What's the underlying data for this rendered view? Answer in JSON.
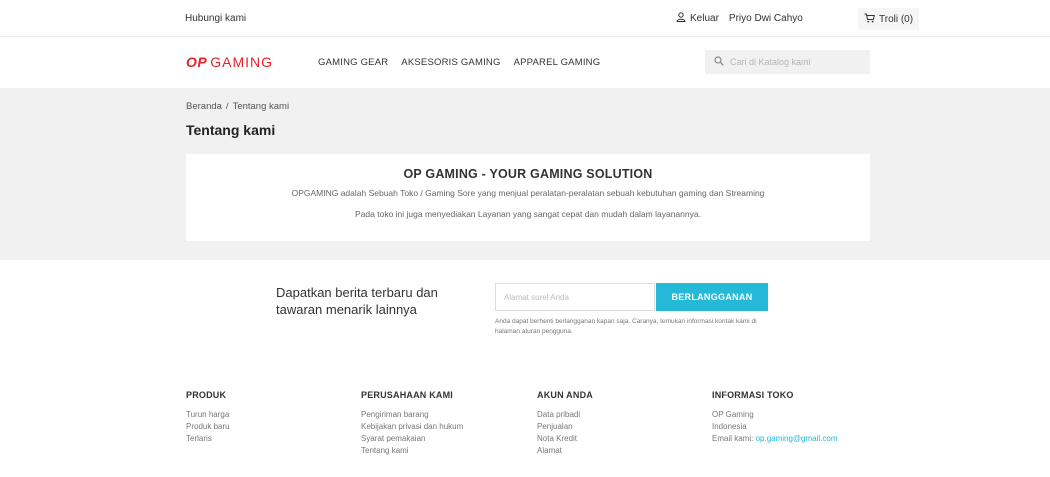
{
  "topbar": {
    "contact": "Hubungi kami",
    "logout_label": "Keluar",
    "user_name": "Priyo Dwi Cahyo",
    "cart_label": "Troli (0)"
  },
  "header": {
    "logo_mark": "OP",
    "logo_text": "GAMING",
    "nav": [
      "GAMING GEAR",
      "AKSESORIS GAMING",
      "APPAREL GAMING"
    ],
    "search_placeholder": "Cari di Katalog kami"
  },
  "breadcrumb": [
    "Beranda",
    "/",
    "Tentang kami"
  ],
  "page_title": "Tentang kami",
  "content": {
    "heading": "OP GAMING - YOUR GAMING SOLUTION",
    "paragraph1": "OPGAMING adalah Sebuah Toko / Gaming Sore yang menjual peralatan-peralatan sebuah kebutuhan gaming dan Streaming",
    "paragraph2": "Pada toko ini juga menyediakan Layanan yang sangat cepat dan mudah dalam layanannya."
  },
  "newsletter": {
    "text": "Dapatkan berita terbaru dan tawaran menarik lainnya",
    "email_placeholder": "Alamat surel Anda",
    "button_label": "BERLANGGANAN",
    "note": "Anda dapat berhenti berlangganan kapan saja. Caranya, temukan informasi kontak kami di halaman aturan pengguna."
  },
  "footer": {
    "produk": {
      "title": "PRODUK",
      "items": [
        "Turun harga",
        "Produk baru",
        "Terlaris"
      ]
    },
    "perusahaan": {
      "title": "PERUSAHAAN KAMI",
      "items": [
        "Pengiriman barang",
        "Kebijakan privasi dan hukum",
        "Syarat pemakaian",
        "Tentang kami"
      ]
    },
    "akun": {
      "title": "AKUN ANDA",
      "items": [
        "Data pribadi",
        "Penjualan",
        "Nota Kredit",
        "Alamat"
      ]
    },
    "info": {
      "title": "INFORMASI TOKO",
      "items": [
        "OP Gaming",
        "Indonesia"
      ],
      "email_label": "Email kami:",
      "email": "op.gaming@gmail.com"
    }
  },
  "colors": {
    "accent": "#24b9d7",
    "brand": "#e8202a",
    "gray_bg": "#f1f1f1"
  }
}
